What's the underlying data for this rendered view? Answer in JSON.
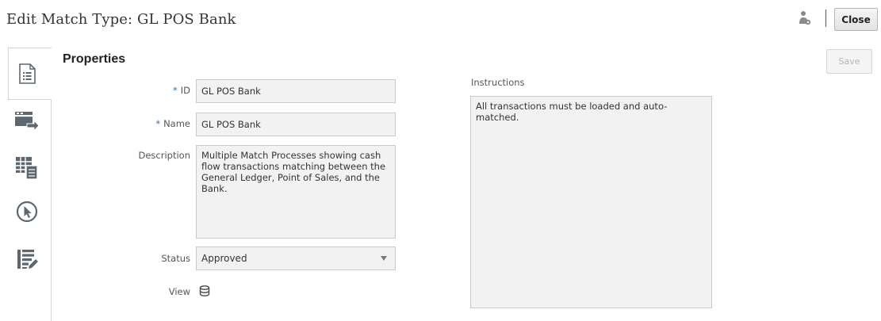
{
  "header": {
    "title": "Edit Match Type: GL POS Bank",
    "close_label": "Close"
  },
  "toolbar": {
    "save_label": "Save"
  },
  "tabs": [
    {
      "icon": "properties-document-icon",
      "active": true
    },
    {
      "icon": "transaction-import-icon",
      "active": false
    },
    {
      "icon": "table-grid-icon",
      "active": false
    },
    {
      "icon": "pointer-cursor-icon",
      "active": false
    },
    {
      "icon": "list-edit-icon",
      "active": false
    }
  ],
  "properties": {
    "section_title": "Properties",
    "id": {
      "label": "ID",
      "required_mark": "*",
      "value": "GL POS Bank"
    },
    "name": {
      "label": "Name",
      "required_mark": "*",
      "value": "GL POS Bank"
    },
    "description": {
      "label": "Description",
      "value": "Multiple Match Processes showing cash flow transactions matching between the General Ledger, Point of Sales, and the Bank."
    },
    "status": {
      "label": "Status",
      "value": "Approved"
    },
    "view": {
      "label": "View",
      "icon": "database-icon"
    }
  },
  "instructions": {
    "label": "Instructions",
    "value": "All transactions must be loaded and auto-matched."
  }
}
